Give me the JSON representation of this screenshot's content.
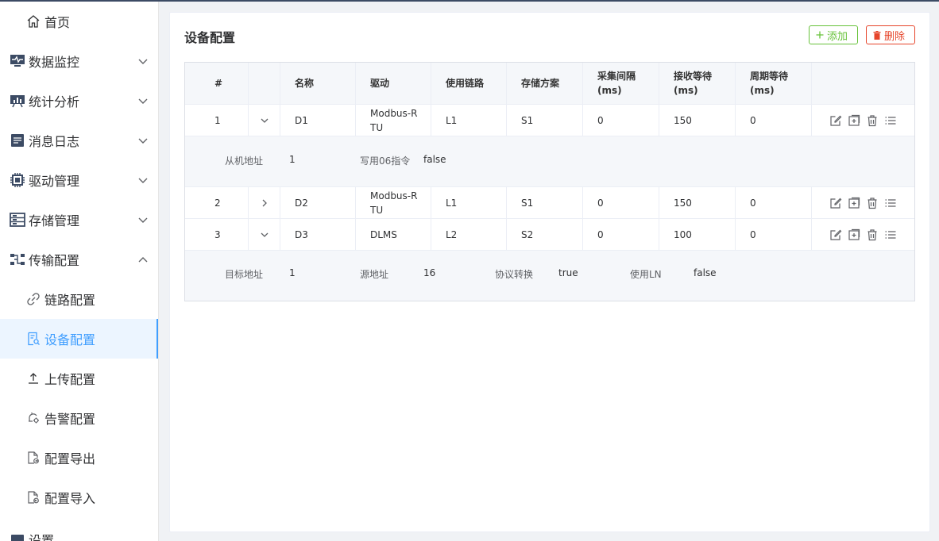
{
  "sidebar": {
    "home": "首页",
    "items": [
      {
        "label": "数据监控",
        "icon": "monitor-icon"
      },
      {
        "label": "统计分析",
        "icon": "chart-board-icon"
      },
      {
        "label": "消息日志",
        "icon": "log-icon"
      },
      {
        "label": "驱动管理",
        "icon": "chip-icon"
      },
      {
        "label": "存储管理",
        "icon": "storage-icon"
      },
      {
        "label": "传输配置",
        "icon": "transfer-icon"
      }
    ],
    "sub_items": [
      {
        "label": "链路配置",
        "icon": "link-icon"
      },
      {
        "label": "设备配置",
        "icon": "device-doc-icon"
      },
      {
        "label": "上传配置",
        "icon": "upload-icon"
      },
      {
        "label": "告警配置",
        "icon": "bell-gear-icon"
      },
      {
        "label": "配置导出",
        "icon": "file-export-icon"
      },
      {
        "label": "配置导入",
        "icon": "file-import-icon"
      }
    ],
    "cut_off": "设置"
  },
  "page": {
    "title": "设备配置",
    "add_label": "添加",
    "delete_label": "删除"
  },
  "table": {
    "headers": [
      "#",
      "",
      "名称",
      "驱动",
      "使用链路",
      "存储方案",
      "采集间隔\n(ms)",
      "接收等待\n(ms)",
      "周期等待\n(ms)",
      ""
    ],
    "rows": [
      {
        "index": "1",
        "name": "D1",
        "driver": "Modbus-R\nTU",
        "link": "L1",
        "storage": "S1",
        "interval": "0",
        "recv_wait": "150",
        "cycle_wait": "0",
        "expanded": true
      },
      {
        "index": "2",
        "name": "D2",
        "driver": "Modbus-R\nTU",
        "link": "L1",
        "storage": "S1",
        "interval": "0",
        "recv_wait": "150",
        "cycle_wait": "0",
        "expanded": false
      },
      {
        "index": "3",
        "name": "D3",
        "driver": "DLMS",
        "link": "L2",
        "storage": "S2",
        "interval": "0",
        "recv_wait": "100",
        "cycle_wait": "0",
        "expanded": true
      }
    ],
    "expand1": [
      {
        "key": "从机地址",
        "value": "1"
      },
      {
        "key": "写用06指令",
        "value": "false"
      }
    ],
    "expand3": [
      {
        "key": "目标地址",
        "value": "1"
      },
      {
        "key": "源地址",
        "value": "16"
      },
      {
        "key": "协议转换",
        "value": "true"
      },
      {
        "key": "使用LN",
        "value": "false"
      }
    ]
  },
  "colors": {
    "accent": "#409eff",
    "add": "#67c23a",
    "delete": "#e6452b"
  }
}
